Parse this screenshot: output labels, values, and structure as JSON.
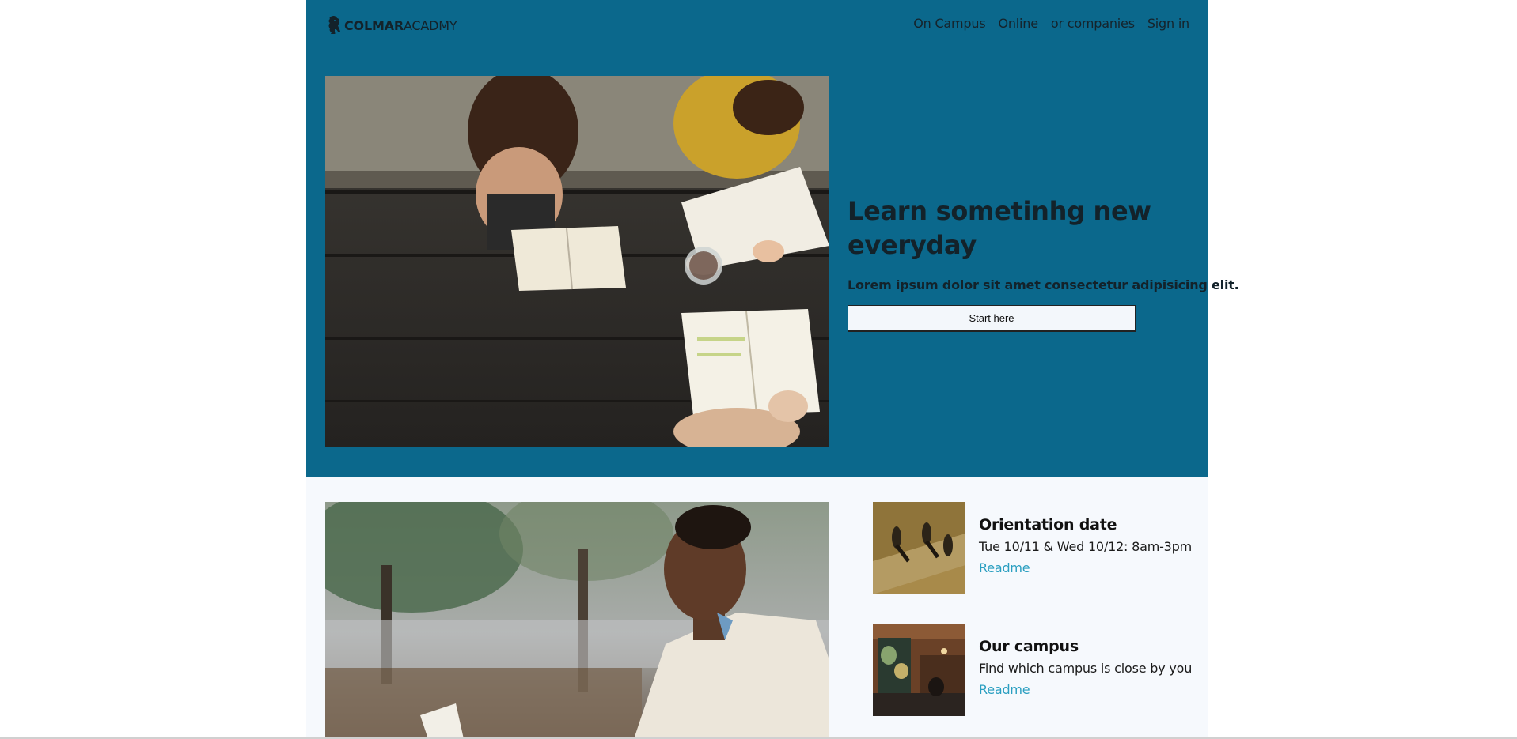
{
  "brand": {
    "name_bold": "COLMAR",
    "name_light": "ACADMY",
    "logo_icon": "lion-icon"
  },
  "nav": {
    "items": [
      "On Campus",
      "Online",
      "or companies",
      "Sign in"
    ]
  },
  "hero": {
    "title": "Learn sometinhg new everyday",
    "subtitle": "Lorem ipsum dolor sit amet consectetur adipisicing elit.",
    "cta_label": "Start here",
    "image": "students-studying-at-table-photo"
  },
  "feature": {
    "image": "man-reading-outdoors-photo"
  },
  "cards": [
    {
      "title": "Orientation date",
      "desc": "Tue 10/11 & Wed 10/12: 8am-3pm",
      "link": "Readme",
      "image": "people-walking-shadows-photo"
    },
    {
      "title": "Our campus",
      "desc": "Find which campus is close by you",
      "link": "Readme",
      "image": "campus-interior-map-photo"
    }
  ],
  "colors": {
    "hero_bg": "#0b688c",
    "lower_bg": "#f6f9fd",
    "link": "#2b9fc1"
  }
}
